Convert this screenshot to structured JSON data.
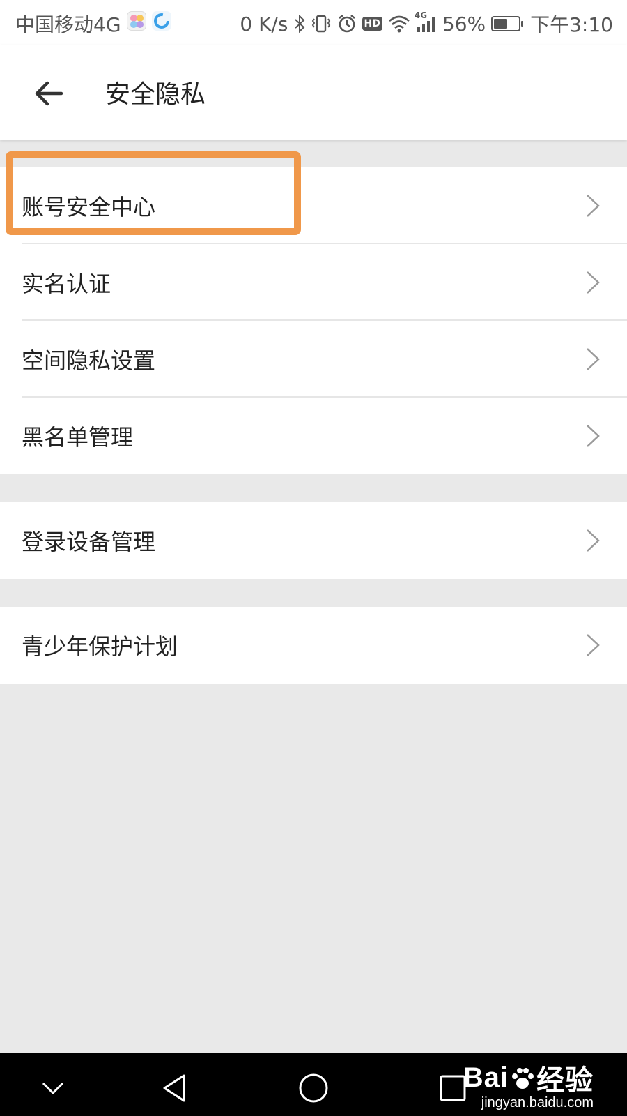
{
  "status_bar": {
    "carrier": "中国移动4G",
    "net_speed": "0 K/s",
    "network_type": "4G",
    "battery": "56%",
    "battery_level": 0.56,
    "time": "下午3:10",
    "icons": [
      "petal-app-icon",
      "browser-app-icon",
      "bluetooth-icon",
      "vibrate-icon",
      "alarm-icon",
      "hd-icon",
      "wifi-icon",
      "signal-icon",
      "battery-icon"
    ],
    "hd_label": "HD"
  },
  "header": {
    "title": "安全隐私",
    "back_icon": "arrow-left-icon"
  },
  "groups": [
    {
      "items": [
        {
          "label": "账号安全中心",
          "icon": "chevron-right-icon"
        },
        {
          "label": "实名认证",
          "icon": "chevron-right-icon"
        },
        {
          "label": "空间隐私设置",
          "icon": "chevron-right-icon"
        },
        {
          "label": "黑名单管理",
          "icon": "chevron-right-icon"
        }
      ]
    },
    {
      "items": [
        {
          "label": "登录设备管理",
          "icon": "chevron-right-icon"
        }
      ]
    },
    {
      "items": [
        {
          "label": "青少年保护计划",
          "icon": "chevron-right-icon"
        }
      ]
    }
  ],
  "highlight": {
    "target": "账号安全中心",
    "color": "#f0984a"
  },
  "nav_bar": {
    "icons": [
      "chevron-down-icon",
      "back-triangle-icon",
      "home-circle-icon",
      "recents-square-icon"
    ]
  },
  "watermark": {
    "brand": "Bai",
    "brand_suffix": "经验",
    "url": "jingyan.baidu.com"
  },
  "colors": {
    "background": "#e9e9e9",
    "surface": "#ffffff",
    "accent_highlight": "#f0984a",
    "chevron": "#9a9a9a",
    "nav_bar": "#000000"
  }
}
